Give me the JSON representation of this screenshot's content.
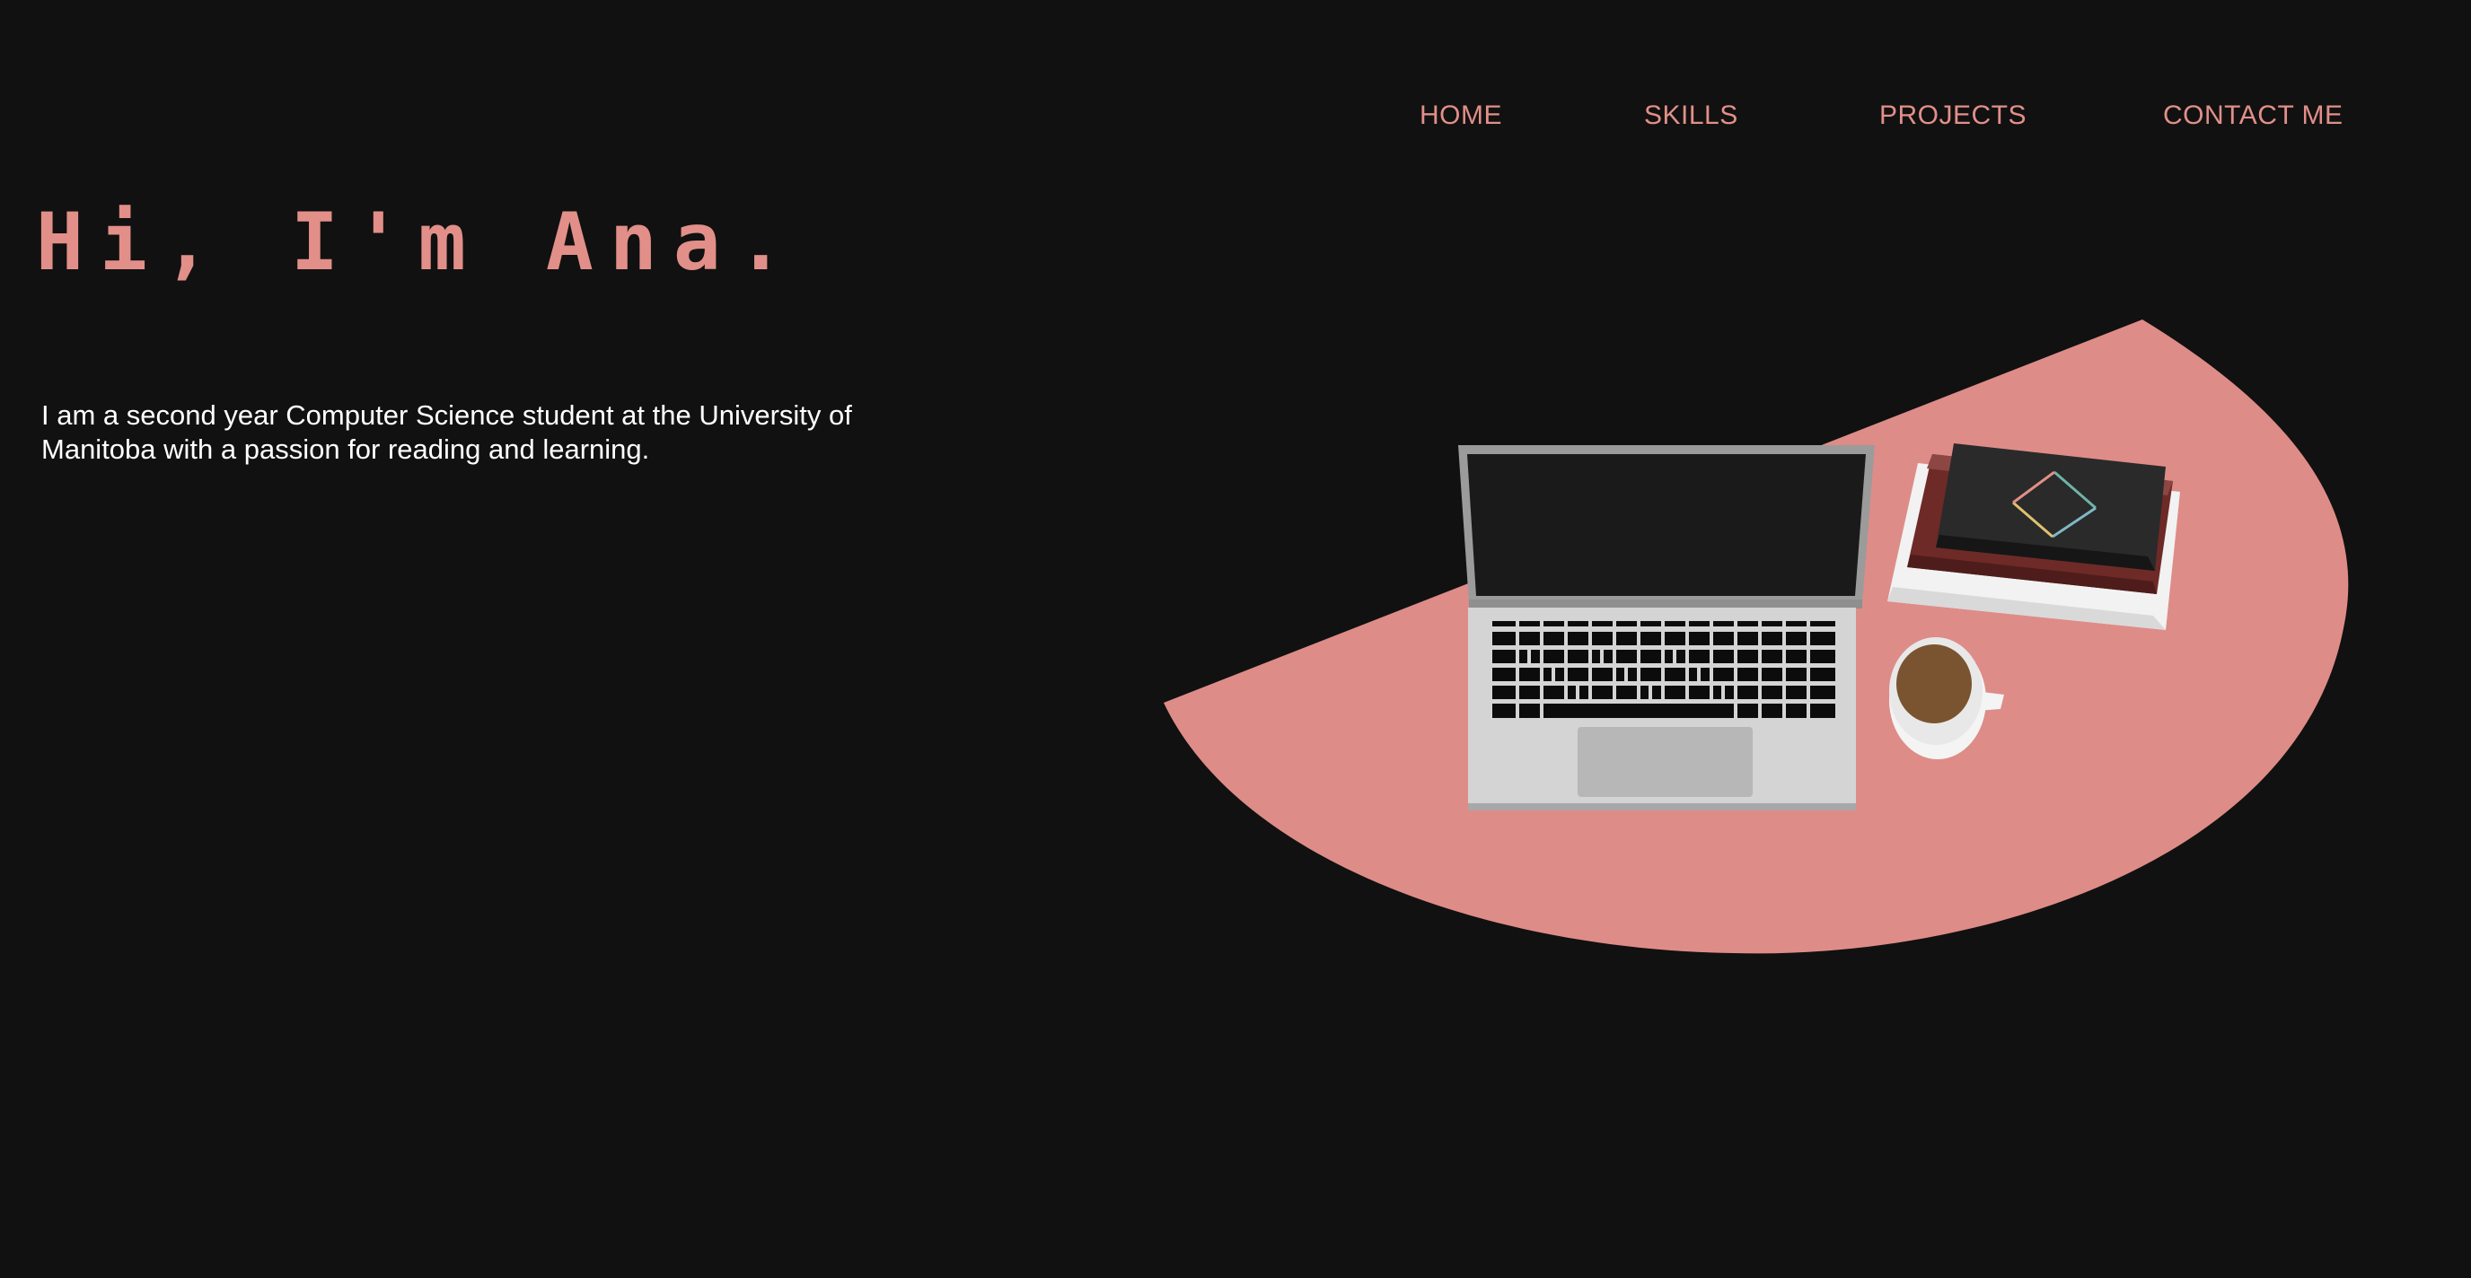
{
  "nav": {
    "items": [
      {
        "label": "HOME"
      },
      {
        "label": "SKILLS"
      },
      {
        "label": "PROJECTS"
      },
      {
        "label": "CONTACT ME"
      }
    ]
  },
  "hero": {
    "title": "Hi, I'm Ana.",
    "intro": "I am a second year Computer Science student at the University of Manitoba with a passion for reading and learning."
  },
  "illustration": {
    "content": [
      "laptop-icon",
      "books-icon",
      "coffee-cup-icon"
    ]
  },
  "colors": {
    "background": "#111111",
    "accent": "#e28f89",
    "text": "#ffffff"
  }
}
